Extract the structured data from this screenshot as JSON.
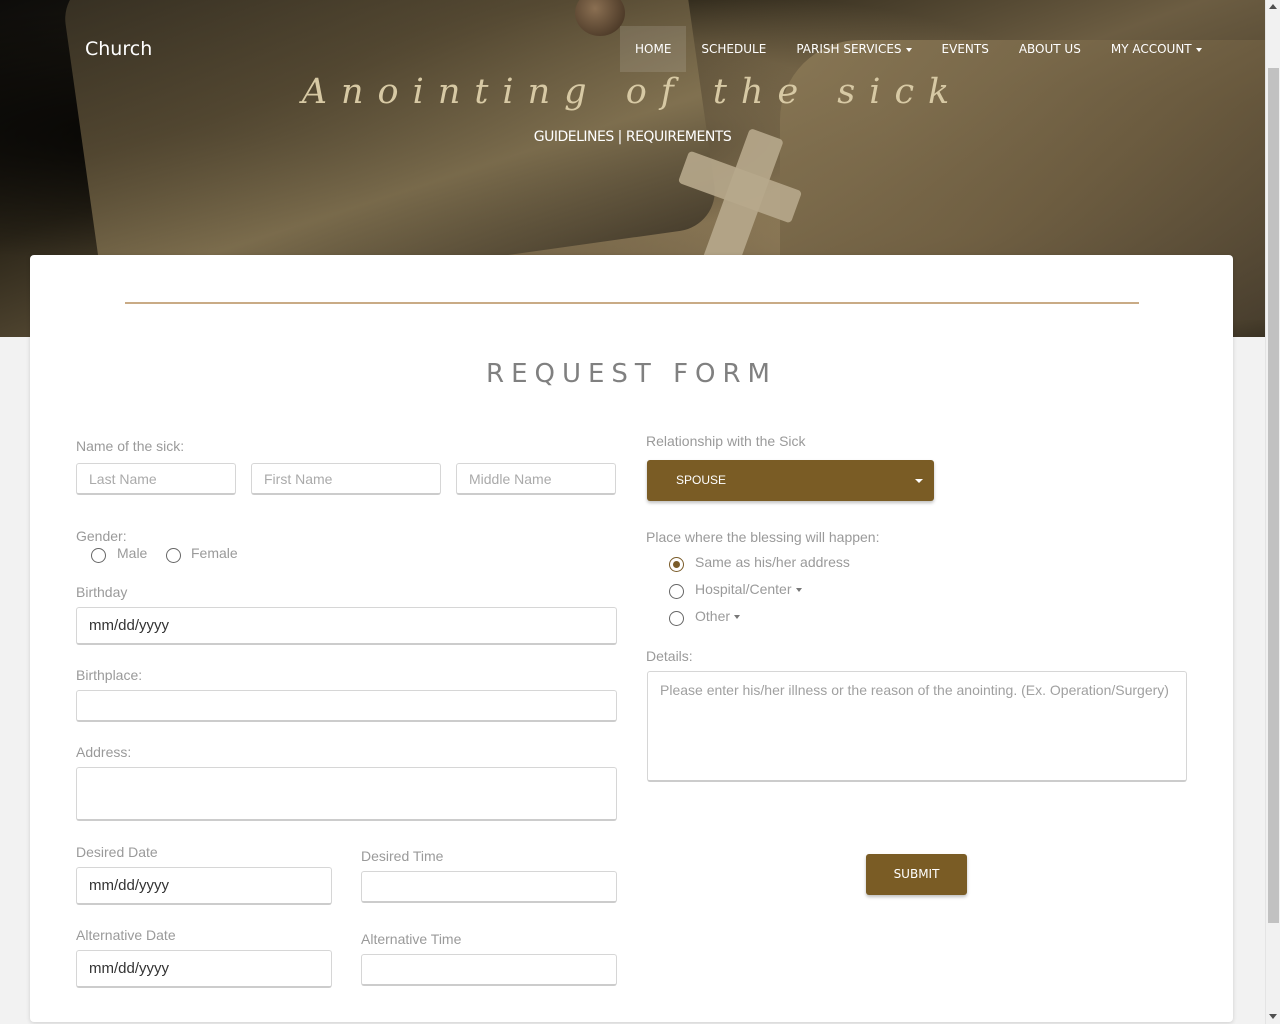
{
  "brand": "Church",
  "nav": {
    "home": "HOME",
    "schedule": "SCHEDULE",
    "parish_services": "PARISH SERVICES",
    "events": "EVENTS",
    "about_us": "ABOUT US",
    "my_account": "MY ACCOUNT"
  },
  "hero": {
    "title": "Anointing of the sick",
    "subtitle": "GUIDELINES | REQUIREMENTS"
  },
  "form": {
    "title": "REQUEST FORM",
    "name_label": "Name of the sick:",
    "last_name_placeholder": "Last Name",
    "first_name_placeholder": "First Name",
    "middle_name_placeholder": "Middle Name",
    "gender_label": "Gender:",
    "male": "Male",
    "female": "Female",
    "birthday_label": "Birthday",
    "birthday_value": "mm/dd/yyyy",
    "birthplace_label": "Birthplace:",
    "address_label": "Address:",
    "desired_date_label": "Desired Date",
    "desired_date_value": "mm/dd/yyyy",
    "desired_time_label": "Desired Time",
    "alternative_date_label": "Alternative Date",
    "alternative_date_value": "mm/dd/yyyy",
    "alternative_time_label": "Alternative Time",
    "relationship_label": "Relationship with the Sick",
    "relationship_value": "SPOUSE",
    "place_label": "Place where the blessing will happen:",
    "place_same": "Same as his/her address",
    "place_hospital": "Hospital/Center",
    "place_other": "Other",
    "details_label": "Details:",
    "details_placeholder": "Please enter his/her illness or the reason of the anointing. (Ex. Operation/Surgery)",
    "submit": "SUBMIT"
  },
  "colors": {
    "accent": "#7a5c25",
    "divider": "#c9ab86"
  }
}
